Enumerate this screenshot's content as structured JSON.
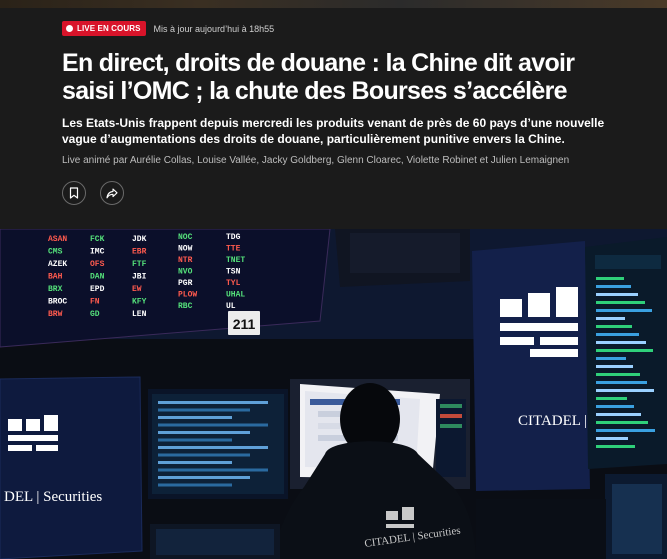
{
  "header": {
    "live_badge": "LIVE EN COURS",
    "updated": "Mis à jour aujourd’hui à 18h55",
    "headline": "En direct, droits de douane : la Chine dit avoir saisi l’OMC ; la chute des Bourses s’accélère",
    "lede": "Les Etats-Unis frappent depuis mercredi les produits venant de près de 60 pays d’une nouvelle vague d’augmentations des droits de douane, particulièrement punitive envers la Chine.",
    "authors": "Live animé par Aurélie Collas, Louise Vallée, Jacky Goldberg, Glenn Cloarec, Violette Robinet et Julien Lemaignen"
  },
  "actions": {
    "bookmark_icon": "bookmark-icon",
    "share_icon": "share-icon"
  },
  "photo": {
    "ticker_left": [
      [
        "ASAN",
        "FCK",
        "JDK"
      ],
      [
        "CMS",
        "IMC",
        "EBR"
      ],
      [
        "AZEK",
        "OFS",
        "FTF"
      ],
      [
        "BAH",
        "DAN",
        "JBI"
      ],
      [
        "BRX",
        "EPD",
        "EW"
      ],
      [
        "BROC",
        "FN",
        "KFY"
      ],
      [
        "BRW",
        "GD",
        "LEN"
      ]
    ],
    "ticker_right": [
      [
        "NOC",
        "TDG"
      ],
      [
        "NOW",
        "TTE"
      ],
      [
        "NTR",
        "TNET"
      ],
      [
        "NVO",
        "TSN"
      ],
      [
        "PGR",
        "TYL"
      ],
      [
        "PLOW",
        "UHAL"
      ],
      [
        "RBC",
        "UL"
      ]
    ],
    "post_number": "211",
    "brand_left": "DEL | Securities",
    "brand_right": "CITADEL | S",
    "jacket_text": "CITADEL | Securities",
    "colors": {
      "live_red": "#d8142a",
      "background": "#1b1b1b",
      "ticker_red": "#ff5a4e",
      "ticker_green": "#54e07a",
      "ticker_white": "#ffffff"
    }
  }
}
